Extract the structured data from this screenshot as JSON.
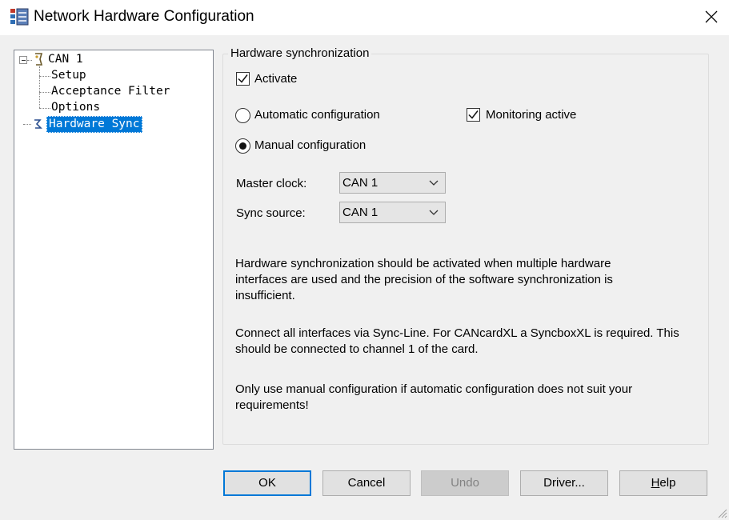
{
  "window": {
    "title": "Network Hardware Configuration"
  },
  "tree": {
    "root": "CAN 1",
    "children": [
      "Setup",
      "Acceptance Filter",
      "Options"
    ],
    "selected": "Hardware Sync"
  },
  "group": {
    "title": "Hardware synchronization",
    "activate": {
      "label": "Activate",
      "checked": true
    },
    "automatic": {
      "label": "Automatic configuration",
      "selected": false
    },
    "monitoring": {
      "label": "Monitoring active",
      "checked": true
    },
    "manual": {
      "label": "Manual configuration",
      "selected": true
    },
    "master_clock": {
      "label": "Master clock:",
      "value": "CAN 1"
    },
    "sync_source": {
      "label": "Sync source:",
      "value": "CAN 1"
    },
    "info": [
      "Hardware synchronization should be activated when multiple hardware interfaces are used and the precision of the software synchronization is insufficient.",
      "Connect all interfaces via Sync-Line. For CANcardXL a SyncboxXL is required. This should be connected to channel 1 of the card.",
      "Only use manual configuration if automatic configuration does not suit your requirements!"
    ]
  },
  "buttons": {
    "ok": "OK",
    "cancel": "Cancel",
    "undo": "Undo",
    "driver": "Driver...",
    "help": "Help"
  },
  "icons": {
    "app": "network-config-icon",
    "close": "close-icon",
    "can": "can-channel-icon",
    "sync": "sync-icon"
  }
}
